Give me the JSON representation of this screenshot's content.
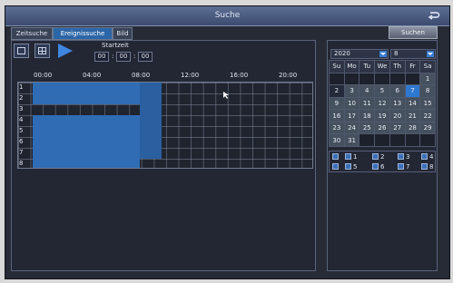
{
  "window": {
    "title": "Suche"
  },
  "tabs": [
    {
      "label": "Zeitsuche"
    },
    {
      "label": "Ereignissuche"
    },
    {
      "label": "Bild"
    }
  ],
  "search_button": "Suchen",
  "toolbar": {
    "start_time_label": "Startzeit",
    "start_time": {
      "hh": "00",
      "mm": "00",
      "ss": "00"
    },
    "sep": ":"
  },
  "timeline": {
    "hour_labels": [
      "00:00",
      "04:00",
      "08:00",
      "12:00",
      "16:00",
      "20:00"
    ],
    "channels": [
      "1",
      "2",
      "3",
      "4",
      "5",
      "6",
      "7",
      "8"
    ],
    "record_color": "#2f6cb4"
  },
  "calendar": {
    "year": "2020",
    "month": "8",
    "weekdays": [
      "Su",
      "Mo",
      "Tu",
      "We",
      "Th",
      "Fr",
      "Sa"
    ],
    "weeks": [
      [
        "",
        "",
        "",
        "",
        "",
        "",
        "1"
      ],
      [
        "2",
        "3",
        "4",
        "5",
        "6",
        "7",
        "8"
      ],
      [
        "9",
        "10",
        "11",
        "12",
        "13",
        "14",
        "15"
      ],
      [
        "16",
        "17",
        "18",
        "19",
        "20",
        "21",
        "22"
      ],
      [
        "23",
        "24",
        "25",
        "26",
        "27",
        "28",
        "29"
      ],
      [
        "30",
        "31",
        "",
        "",
        "",
        "",
        ""
      ]
    ],
    "recorded_days": [
      "1",
      "3",
      "4",
      "5",
      "6",
      "8",
      "9",
      "10",
      "11",
      "12",
      "13",
      "14",
      "15",
      "16",
      "17",
      "18",
      "19",
      "20",
      "21",
      "22",
      "23",
      "24",
      "25",
      "26",
      "27",
      "28",
      "29",
      "30",
      "31"
    ],
    "selected_day": "7",
    "accent_color": "#2f78d0"
  },
  "channel_select": [
    "1",
    "2",
    "3",
    "4",
    "5",
    "6",
    "7",
    "8"
  ]
}
